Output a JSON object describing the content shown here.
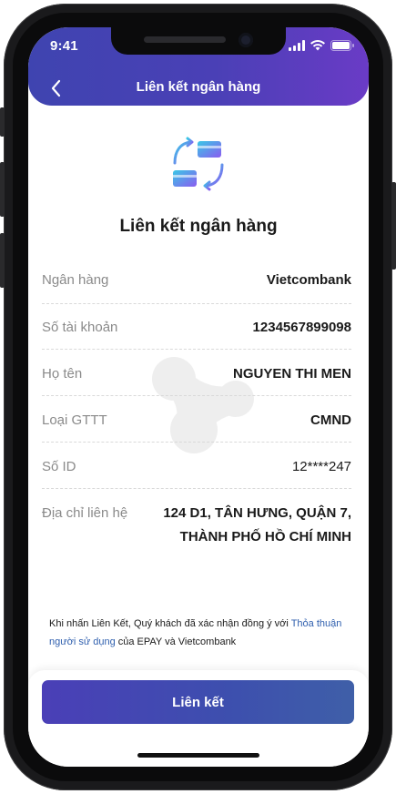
{
  "status_bar": {
    "time": "9:41"
  },
  "header": {
    "title": "Liên kết ngân hàng"
  },
  "main": {
    "heading": "Liên kết ngân hàng",
    "rows": [
      {
        "label": "Ngân hàng",
        "value": "Vietcombank"
      },
      {
        "label": "Số tài khoản",
        "value": "1234567899098"
      },
      {
        "label": "Họ tên",
        "value": "NGUYEN THI MEN"
      },
      {
        "label": "Loại GTTT",
        "value": "CMND"
      },
      {
        "label": "Số ID",
        "value": "12****247"
      },
      {
        "label": "Địa chỉ liên hệ",
        "value_line1": "124 D1, TÂN HƯNG, QUẬN 7,",
        "value_line2": "THÀNH PHỐ HỒ CHÍ MINH"
      }
    ],
    "terms": {
      "prefix": "Khi nhấn Liên Kết, Quý khách đã xác nhận đồng ý với ",
      "link": "Thỏa thuận người sử dụng",
      "suffix": " của EPAY và Vietcombank"
    }
  },
  "footer": {
    "cta_label": "Liên kết"
  },
  "icons": {
    "back": "chevron-left-icon",
    "hero": "card-link-icon",
    "signal": "cellular-signal-icon",
    "wifi": "wifi-icon",
    "battery": "battery-icon"
  },
  "colors": {
    "header_start": "#3f44b0",
    "header_end": "#6a3bc6",
    "accent_cyan": "#39c8e6",
    "accent_purple": "#8a5cf0",
    "cta": "#4a3fb7",
    "link": "#2f5fae"
  }
}
